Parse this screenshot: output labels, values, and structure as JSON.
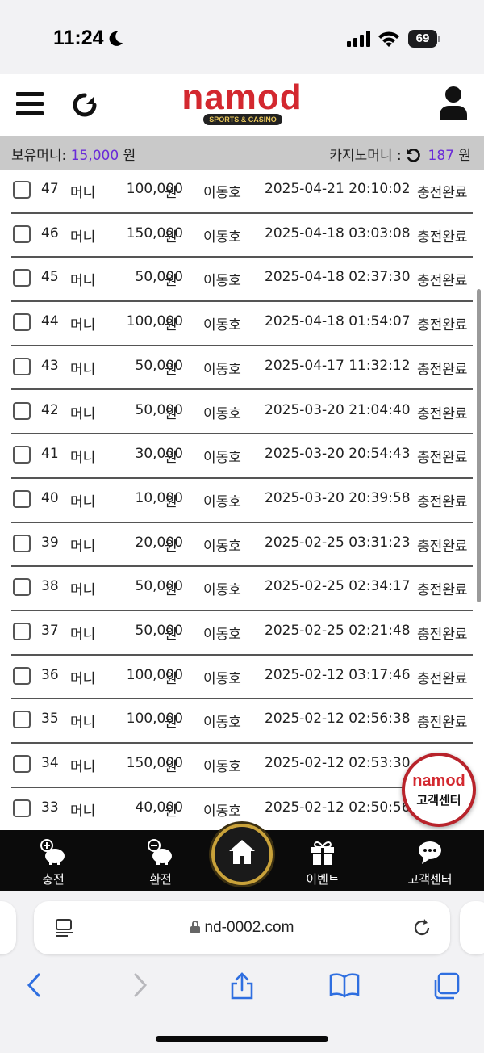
{
  "status_bar": {
    "time": "11:24",
    "battery": "69"
  },
  "header": {
    "logo": "namod",
    "logo_sub": "SPORTS & CASINO"
  },
  "balance": {
    "money_label": "보유머니:",
    "money_value": "15,000",
    "money_unit": "원",
    "casino_label": "카지노머니 :",
    "casino_value": "187",
    "casino_unit": "원"
  },
  "rows": [
    {
      "num": "47",
      "type": "머니",
      "amount": "100,000",
      "unit": "원",
      "name": "이동호",
      "date": "2025-04-21 20:10:02",
      "status": "충전완료"
    },
    {
      "num": "46",
      "type": "머니",
      "amount": "150,000",
      "unit": "원",
      "name": "이동호",
      "date": "2025-04-18 03:03:08",
      "status": "충전완료"
    },
    {
      "num": "45",
      "type": "머니",
      "amount": "50,000",
      "unit": "원",
      "name": "이동호",
      "date": "2025-04-18 02:37:30",
      "status": "충전완료"
    },
    {
      "num": "44",
      "type": "머니",
      "amount": "100,000",
      "unit": "원",
      "name": "이동호",
      "date": "2025-04-18 01:54:07",
      "status": "충전완료"
    },
    {
      "num": "43",
      "type": "머니",
      "amount": "50,000",
      "unit": "원",
      "name": "이동호",
      "date": "2025-04-17 11:32:12",
      "status": "충전완료"
    },
    {
      "num": "42",
      "type": "머니",
      "amount": "50,000",
      "unit": "원",
      "name": "이동호",
      "date": "2025-03-20 21:04:40",
      "status": "충전완료"
    },
    {
      "num": "41",
      "type": "머니",
      "amount": "30,000",
      "unit": "원",
      "name": "이동호",
      "date": "2025-03-20 20:54:43",
      "status": "충전완료"
    },
    {
      "num": "40",
      "type": "머니",
      "amount": "10,000",
      "unit": "원",
      "name": "이동호",
      "date": "2025-03-20 20:39:58",
      "status": "충전완료"
    },
    {
      "num": "39",
      "type": "머니",
      "amount": "20,000",
      "unit": "원",
      "name": "이동호",
      "date": "2025-02-25 03:31:23",
      "status": "충전완료"
    },
    {
      "num": "38",
      "type": "머니",
      "amount": "50,000",
      "unit": "원",
      "name": "이동호",
      "date": "2025-02-25 02:34:17",
      "status": "충전완료"
    },
    {
      "num": "37",
      "type": "머니",
      "amount": "50,000",
      "unit": "원",
      "name": "이동호",
      "date": "2025-02-25 02:21:48",
      "status": "충전완료"
    },
    {
      "num": "36",
      "type": "머니",
      "amount": "100,000",
      "unit": "원",
      "name": "이동호",
      "date": "2025-02-12 03:17:46",
      "status": "충전완료"
    },
    {
      "num": "35",
      "type": "머니",
      "amount": "100,000",
      "unit": "원",
      "name": "이동호",
      "date": "2025-02-12 02:56:38",
      "status": "충전완료"
    },
    {
      "num": "34",
      "type": "머니",
      "amount": "150,000",
      "unit": "원",
      "name": "이동호",
      "date": "2025-02-12 02:53:30",
      "status": ""
    },
    {
      "num": "33",
      "type": "머니",
      "amount": "40,000",
      "unit": "원",
      "name": "이동호",
      "date": "2025-02-12 02:50:56",
      "status": ""
    }
  ],
  "cs_badge": {
    "logo": "namod",
    "label": "고객센터"
  },
  "nav": [
    {
      "label": "충전",
      "icon": "piggy-plus-icon"
    },
    {
      "label": "환전",
      "icon": "piggy-minus-icon"
    },
    {
      "label": "",
      "icon": "home-icon"
    },
    {
      "label": "이벤트",
      "icon": "gift-icon"
    },
    {
      "label": "고객센터",
      "icon": "support-chat-icon"
    }
  ],
  "browser": {
    "url": "nd-0002.com"
  },
  "colors": {
    "accent": "#6a2bd8",
    "brand_red": "#d3282f",
    "gold": "#c9a23a"
  }
}
